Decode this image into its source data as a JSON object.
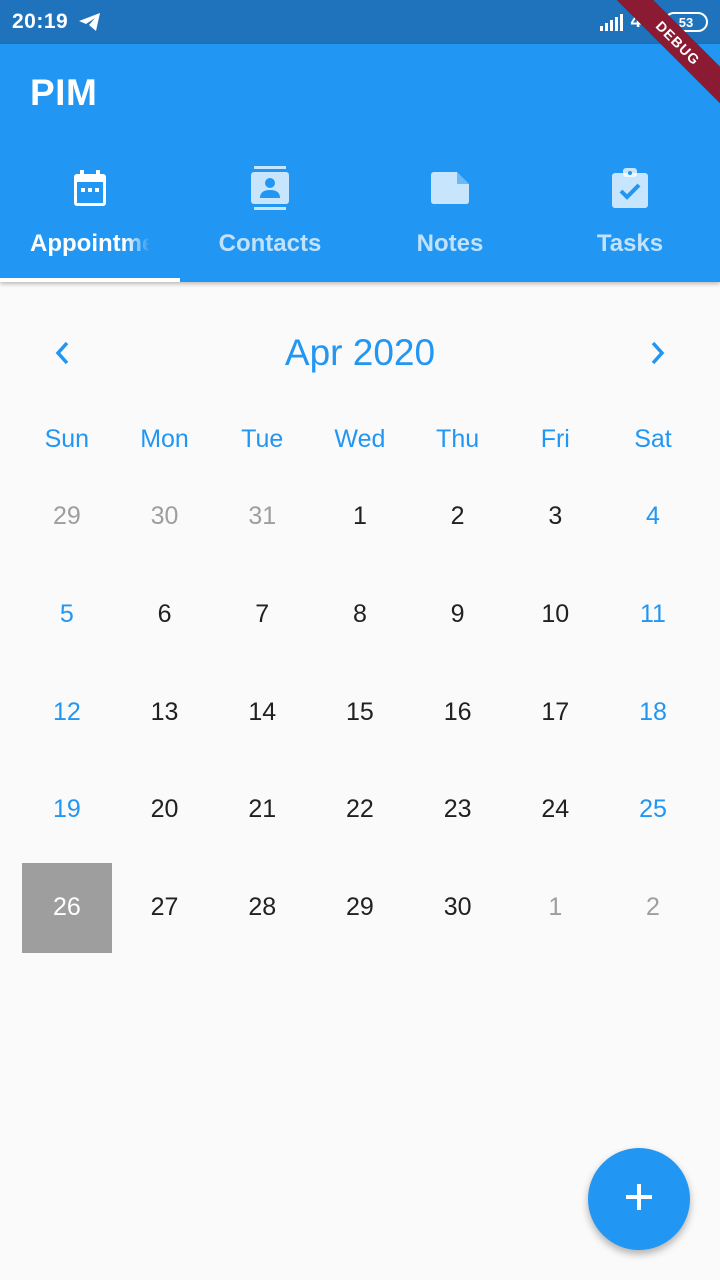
{
  "status_bar": {
    "time": "20:19",
    "network": "4G",
    "battery": "53",
    "icons": [
      "telegram-icon",
      "signal-icon",
      "battery-icon"
    ]
  },
  "debug_banner": "DEBUG",
  "app_bar": {
    "title": "PIM",
    "tabs": [
      {
        "label": "Appointments",
        "icon": "calendar-icon",
        "active": true
      },
      {
        "label": "Contacts",
        "icon": "contact-card-icon",
        "active": false
      },
      {
        "label": "Notes",
        "icon": "note-icon",
        "active": false
      },
      {
        "label": "Tasks",
        "icon": "clipboard-check-icon",
        "active": false
      }
    ]
  },
  "calendar": {
    "month_title": "Apr 2020",
    "prev_icon": "chevron-left-icon",
    "next_icon": "chevron-right-icon",
    "weekdays": [
      "Sun",
      "Mon",
      "Tue",
      "Wed",
      "Thu",
      "Fri",
      "Sat"
    ],
    "weeks": [
      [
        "29",
        "30",
        "31",
        "1",
        "2",
        "3",
        "4"
      ],
      [
        "5",
        "6",
        "7",
        "8",
        "9",
        "10",
        "11"
      ],
      [
        "12",
        "13",
        "14",
        "15",
        "16",
        "17",
        "18"
      ],
      [
        "19",
        "20",
        "21",
        "22",
        "23",
        "24",
        "25"
      ],
      [
        "26",
        "27",
        "28",
        "29",
        "30",
        "1",
        "2"
      ]
    ],
    "selected_day": "26"
  },
  "fab": {
    "icon": "plus-icon"
  },
  "colors": {
    "primary": "#2196f3",
    "status_bar": "#1f73bc",
    "selected_day": "#9e9e9e",
    "muted_day": "#9e9e9e",
    "debug_banner": "#8b1a33"
  }
}
